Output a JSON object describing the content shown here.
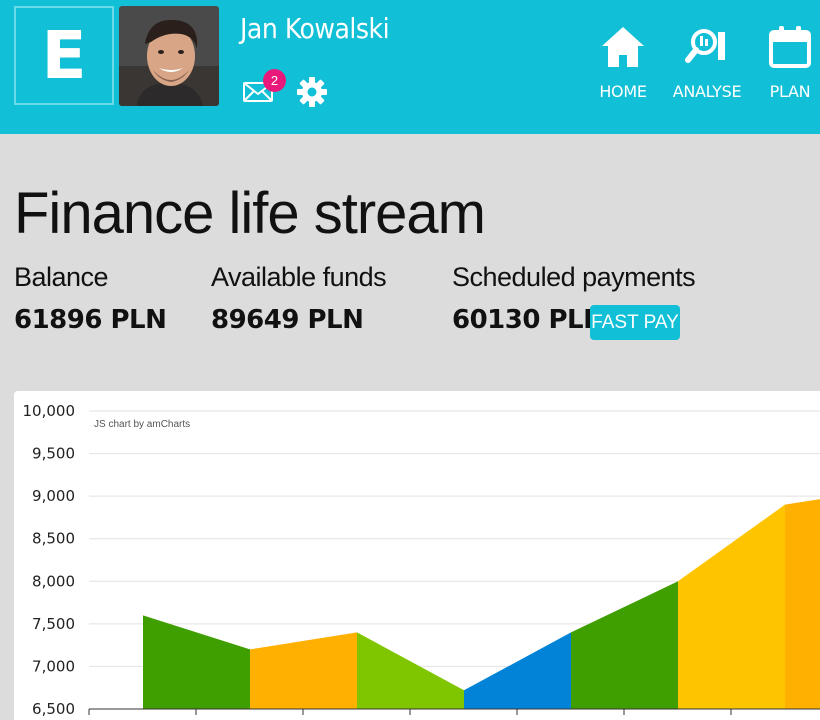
{
  "header": {
    "logo_letter": "E",
    "username": "Jan Kowalski",
    "mail_count": "2",
    "icons": [
      "mail-icon",
      "gear-icon",
      "home-icon",
      "analyse-icon",
      "calendar-icon"
    ],
    "nav": [
      {
        "label": "HOME"
      },
      {
        "label": "ANALYSE"
      },
      {
        "label": "PLAN"
      }
    ],
    "colors": {
      "primary": "#11bfd6",
      "badge": "#e8197a"
    }
  },
  "main": {
    "title": "Finance life stream",
    "stats": [
      {
        "label": "Balance",
        "value": "61896 PLN"
      },
      {
        "label": "Available funds",
        "value": "89649 PLN"
      },
      {
        "label": "Scheduled payments",
        "value": "60130 PLN"
      }
    ],
    "fast_pay_label": "FAST PAY"
  },
  "chart_data": {
    "type": "area",
    "credit": "JS chart by amCharts",
    "ylim": [
      6500,
      10000
    ],
    "yticks": [
      "10,000",
      "9,500",
      "9,000",
      "8,500",
      "8,000",
      "7,500",
      "7,000",
      "6,500"
    ],
    "grid": true,
    "segments": [
      {
        "from": 7600,
        "to": 7200,
        "color": "#3f9e00"
      },
      {
        "from": 7200,
        "to": 7400,
        "color": "#ffb000"
      },
      {
        "from": 7400,
        "to": 6720,
        "color": "#80c600"
      },
      {
        "from": 6720,
        "to": 7400,
        "color": "#0383d8"
      },
      {
        "from": 7400,
        "to": 8000,
        "color": "#3f9e00"
      },
      {
        "from": 8000,
        "to": 8900,
        "color": "#ffc400"
      },
      {
        "from": 8900,
        "to": 9100,
        "color": "#ffb000"
      }
    ]
  }
}
